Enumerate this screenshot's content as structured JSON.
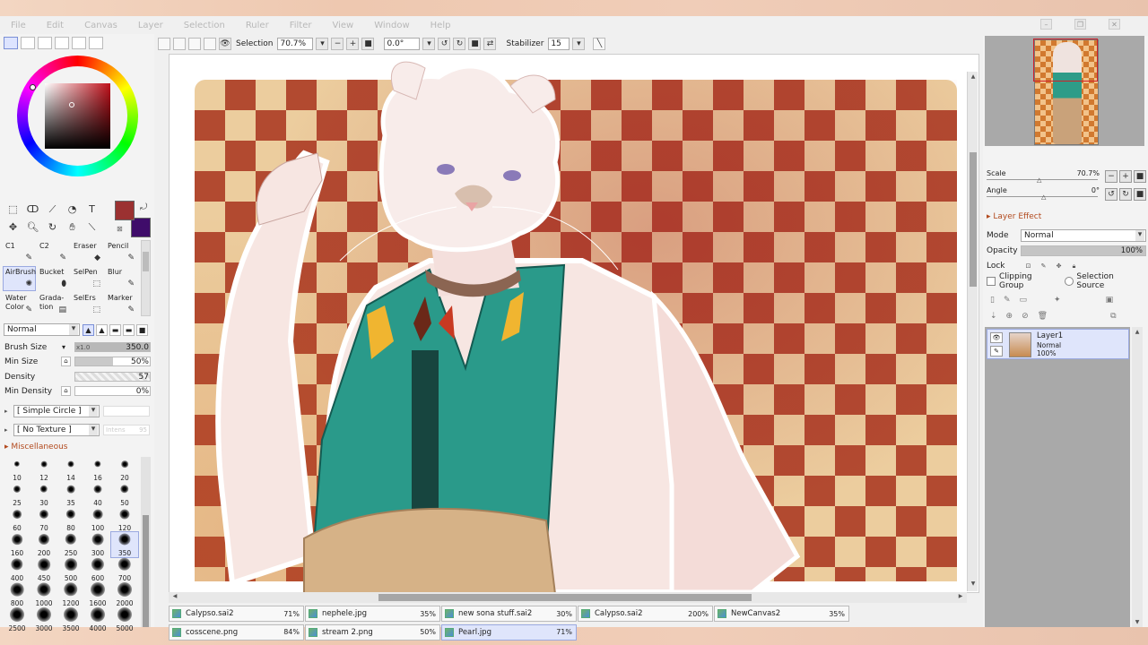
{
  "menu": [
    "File",
    "Edit",
    "Canvas",
    "Layer",
    "Selection",
    "Ruler",
    "Filter",
    "View",
    "Window",
    "Help"
  ],
  "toolbar": {
    "selection_label": "Selection",
    "zoom": "70.7%",
    "angle": "0.0°",
    "stabilizer_label": "Stabilizer",
    "stabilizer_value": "15"
  },
  "tools": [
    "marquee-icon",
    "lasso-icon",
    "magic-wand-icon",
    "shape-icon",
    "text-icon",
    "move-icon",
    "zoom-icon",
    "rotate-icon",
    "hand-icon",
    "eyedropper-icon"
  ],
  "colors": {
    "foreground": "#9b3131",
    "background": "#3f0c6a",
    "accent": "#b24a1e"
  },
  "brushes": [
    {
      "label": "C1",
      "selected": false
    },
    {
      "label": "C2",
      "selected": false
    },
    {
      "label": "Eraser",
      "selected": false
    },
    {
      "label": "Pencil",
      "selected": false
    },
    {
      "label": "AirBrush",
      "selected": true
    },
    {
      "label": "Bucket",
      "selected": false
    },
    {
      "label": "SelPen",
      "selected": false
    },
    {
      "label": "Blur",
      "selected": false
    },
    {
      "label": "Water Color",
      "selected": false
    },
    {
      "label": "Grada-tion",
      "selected": false
    },
    {
      "label": "SelErs",
      "selected": false
    },
    {
      "label": "Marker",
      "selected": false
    }
  ],
  "brush_settings": {
    "blend_mode": "Normal",
    "brush_size_label": "Brush Size",
    "brush_size_multiplier": "x1.0",
    "brush_size": "350.0",
    "min_size_label": "Min Size",
    "min_size": "50%",
    "min_size_fraction": 0.5,
    "density_label": "Density",
    "density": "57",
    "min_density_label": "Min Density",
    "min_density": "0%",
    "shape": "[ Simple Circle ]",
    "texture": "[ No Texture ]",
    "texture_intensity_label": "Intens",
    "texture_intensity": "95",
    "misc_label": "Miscellaneous"
  },
  "brush_sizes": [
    "10",
    "12",
    "14",
    "16",
    "20",
    "25",
    "30",
    "35",
    "40",
    "50",
    "60",
    "70",
    "80",
    "100",
    "120",
    "160",
    "200",
    "250",
    "300",
    "350",
    "400",
    "450",
    "500",
    "600",
    "700",
    "800",
    "1000",
    "1200",
    "1600",
    "2000",
    "2500",
    "3000",
    "3500",
    "4000",
    "5000"
  ],
  "selected_size": "350",
  "files": [
    {
      "name": "Calypso.sai2",
      "pct": "71%",
      "active": false
    },
    {
      "name": "nephele.jpg",
      "pct": "35%",
      "active": false
    },
    {
      "name": "new sona stuff.sai2",
      "pct": "30%",
      "active": false
    },
    {
      "name": "Calypso.sai2",
      "pct": "200%",
      "active": false
    },
    {
      "name": "NewCanvas2",
      "pct": "35%",
      "active": false
    },
    {
      "name": "cosscene.png",
      "pct": "84%",
      "active": false
    },
    {
      "name": "stream 2.png",
      "pct": "50%",
      "active": false
    },
    {
      "name": "Pearl.jpg",
      "pct": "71%",
      "active": true
    }
  ],
  "navigator": {
    "scale_label": "Scale",
    "scale": "70.7%",
    "angle_label": "Angle",
    "angle": "0°"
  },
  "layer_panel": {
    "effect_label": "Layer Effect",
    "mode_label": "Mode",
    "mode": "Normal",
    "opacity_label": "Opacity",
    "opacity": "100%",
    "lock_label": "Lock",
    "clipping_label": "Clipping Group",
    "selection_source_label": "Selection Source",
    "layers": [
      {
        "name": "Layer1",
        "mode": "Normal",
        "opacity": "100%"
      }
    ]
  }
}
